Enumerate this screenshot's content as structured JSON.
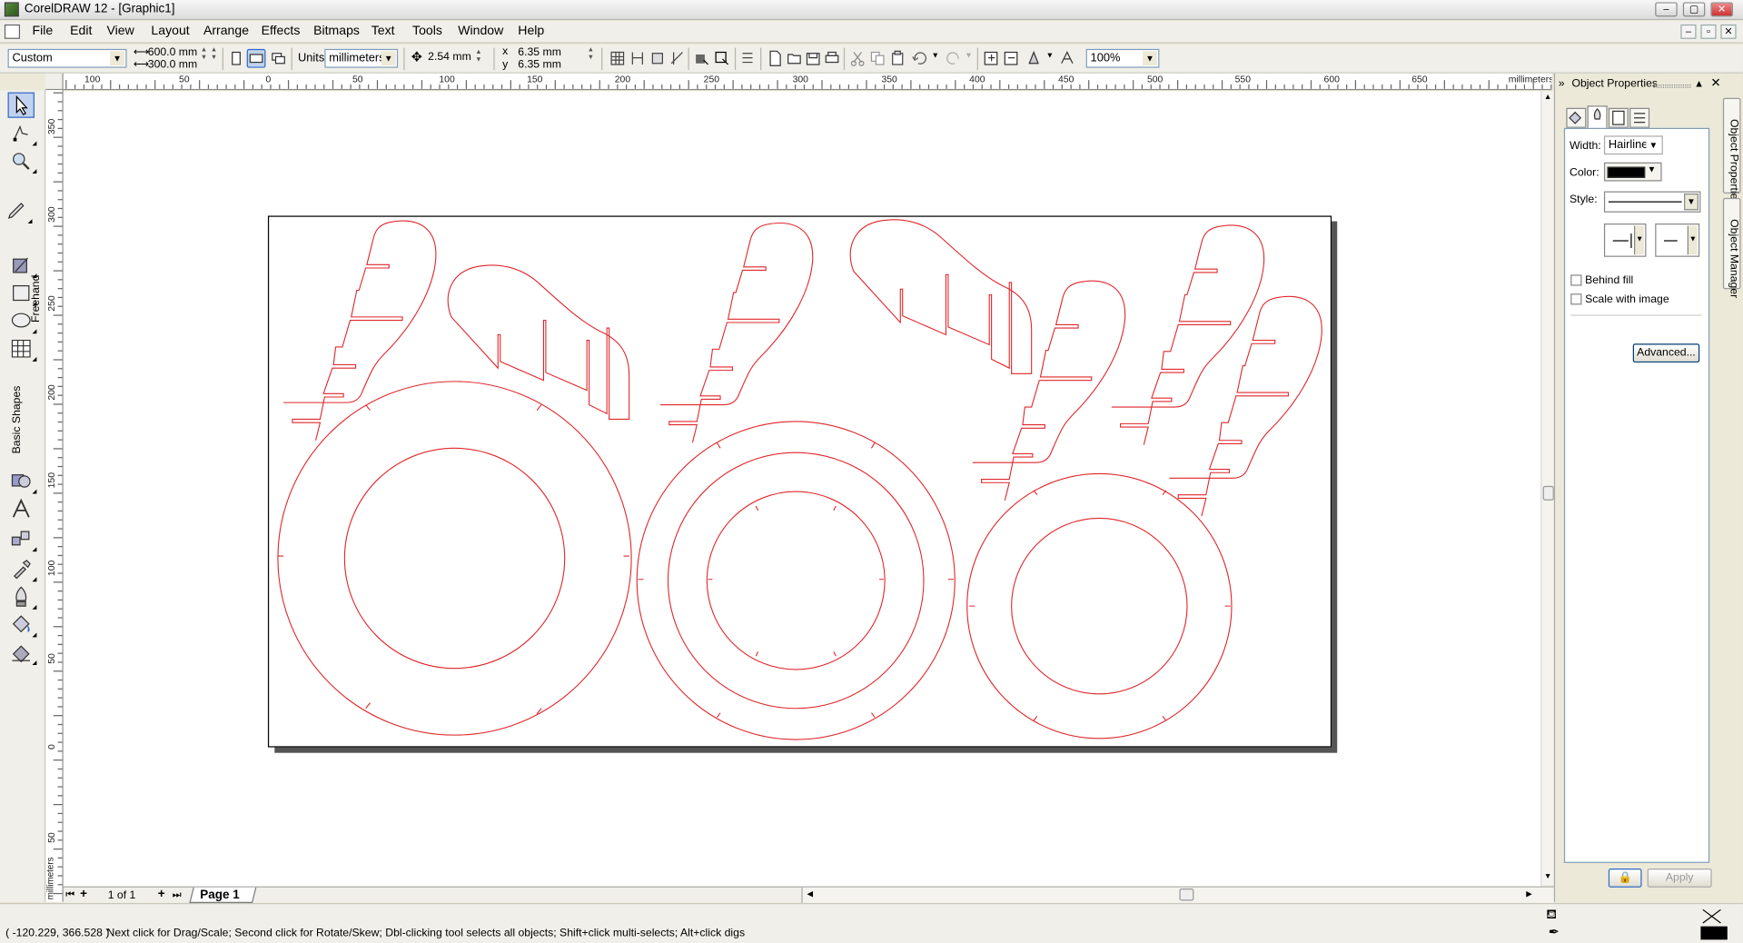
{
  "window": {
    "title": "CorelDRAW 12 - [Graphic1]",
    "min_label": "–",
    "max_label": "▢",
    "close_label": "✕"
  },
  "menu": {
    "items": [
      "File",
      "Edit",
      "View",
      "Layout",
      "Arrange",
      "Effects",
      "Bitmaps",
      "Text",
      "Tools",
      "Window",
      "Help"
    ]
  },
  "propbar": {
    "paper_preset": "Custom",
    "width_value": "600.0 mm",
    "height_value": "300.0 mm",
    "units_label": "Units:",
    "units_value": "millimeters",
    "nudge_value": "2.54 mm",
    "dup_x_label": "x",
    "dup_x_value": "6.35 mm",
    "dup_y_label": "y",
    "dup_y_value": "6.35 mm",
    "zoom_value": "100%"
  },
  "rulers": {
    "unit_label": "millimeters",
    "h_ticks": [
      "100",
      "50",
      "0",
      "50",
      "100",
      "150",
      "200",
      "250",
      "300",
      "350",
      "400",
      "450",
      "500",
      "550",
      "600",
      "650"
    ],
    "v_ticks": [
      "350",
      "300",
      "250",
      "200",
      "150",
      "100",
      "50",
      "0",
      "50"
    ]
  },
  "toolbox": {
    "freehand_label": "Freehand",
    "basic_shapes_label": "Basic Shapes"
  },
  "page_nav": {
    "count": "1 of 1",
    "tab": "Page 1"
  },
  "docker": {
    "title": "Object Properties",
    "width_label": "Width:",
    "width_value": "Hairline",
    "color_label": "Color:",
    "color_value": "#000000",
    "style_label": "Style:",
    "behind_fill_label": "Behind fill",
    "scale_image_label": "Scale with image",
    "advanced_label": "Advanced...",
    "apply_label": "Apply",
    "tab_object_properties": "Object Properties",
    "tab_object_manager": "Object Manager"
  },
  "status": {
    "coords": "( -120.229, 366.528 )",
    "hint": "Next click for Drag/Scale; Second click for Rotate/Skew; Dbl-clicking tool selects all objects; Shift+click multi-selects; Alt+click digs"
  },
  "colors": {
    "outline_red": "#e0262a",
    "selection_blue": "#316ac5"
  }
}
